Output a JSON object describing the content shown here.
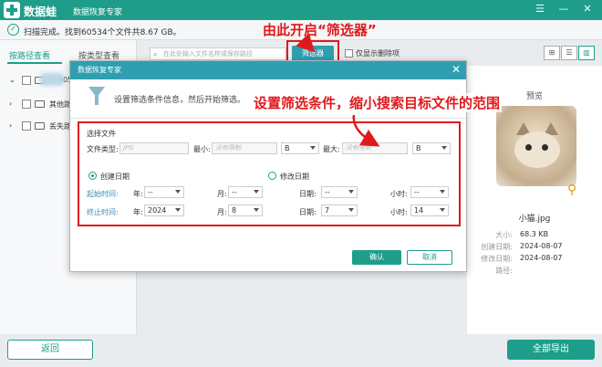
{
  "app": {
    "name": "数据蛙",
    "subtitle": "数据恢复专家",
    "window_controls": [
      "☰",
      "—",
      "✕"
    ]
  },
  "status": {
    "text": "扫描完成。找到60534个文件共8.67 GB。"
  },
  "left_panel": {
    "tabs": [
      "按路径查看",
      "按类型查看"
    ],
    "tree": [
      {
        "label": "60534",
        "caret": "⌄"
      },
      {
        "label": "其他路",
        "caret": "›"
      },
      {
        "label": "丢失路",
        "caret": "›"
      }
    ]
  },
  "toolbar": {
    "search_placeholder": "在此处输入文件名称或保存路径",
    "filter_label": "筛选器",
    "show_deleted_label": "仅显示删除项",
    "view_icons": [
      "⊞",
      "☰",
      "▥"
    ]
  },
  "preview": {
    "title": "预览",
    "file_name": "小猫.jpg",
    "meta": [
      {
        "k": "大小:",
        "v": "68.3 KB"
      },
      {
        "k": "创建日期:",
        "v": "2024-08-07"
      },
      {
        "k": "修改日期:",
        "v": "2024-08-07"
      },
      {
        "k": "路径:",
        "v": ""
      }
    ]
  },
  "bottom": {
    "back_label": "返回",
    "export_label": "全部导出"
  },
  "dialog": {
    "title": "数据恢复专家",
    "close": "✕",
    "description": "设置筛选条件信息，然后开始筛选。",
    "section_title": "选择文件",
    "file_type_label": "文件类型:",
    "file_type_placeholder": "JPG",
    "min_size_label": "最小:",
    "min_placeholder": "没有限制",
    "min_unit": "B",
    "max_size_label": "最大:",
    "max_placeholder": "没有限制",
    "max_unit": "B",
    "radio_created": "创建日期",
    "radio_modified": "修改日期",
    "start_label": "起始时间:",
    "end_label": "终止时间:",
    "year_label": "年:",
    "month_label": "月:",
    "day_label": "日期:",
    "hour_label": "小时:",
    "start": {
      "year": "--",
      "month": "--",
      "day": "--",
      "hour": "--"
    },
    "end": {
      "year": "2024",
      "month": "8",
      "day": "7",
      "hour": "14"
    },
    "ok_label": "确认",
    "cancel_label": "取消"
  },
  "annotations": {
    "top": "由此开启“筛选器”",
    "middle": "设置筛选条件，缩小搜索目标文件的范围"
  },
  "colors": {
    "brand": "#1e9e8a",
    "dialog_header": "#2f9fb0",
    "annotation": "#e0191c"
  }
}
